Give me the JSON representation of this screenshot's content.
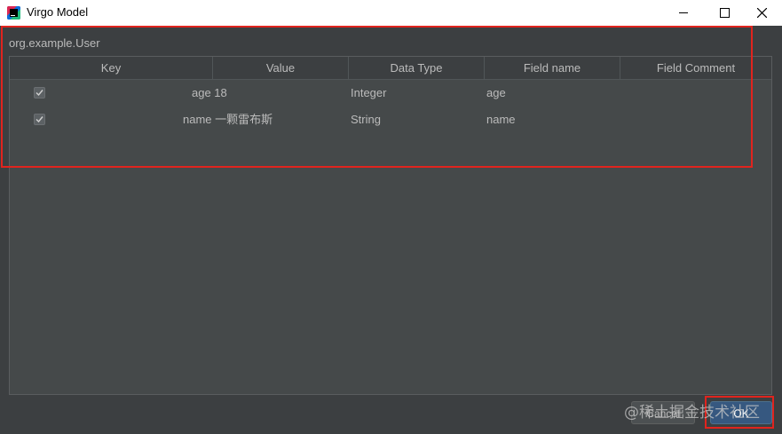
{
  "window": {
    "title": "Virgo Model",
    "icon": "intellij-app-icon"
  },
  "class_name": "org.example.User",
  "table": {
    "columns": [
      "Key",
      "Value",
      "Data Type",
      "Field name",
      "Field Comment"
    ],
    "rows": [
      {
        "checked": true,
        "value": "age 18",
        "data_type": "Integer",
        "field_name": "age",
        "field_comment": ""
      },
      {
        "checked": true,
        "value": "name 一颗雷布斯",
        "data_type": "String",
        "field_name": "name",
        "field_comment": ""
      }
    ]
  },
  "buttons": {
    "cancel": "Cancel",
    "ok": "OK"
  },
  "watermark": "@稀土掘金技术社区",
  "colors": {
    "background": "#3c3f41",
    "table_background": "#45494a",
    "highlight_frame": "#e0241e",
    "ok_button": "#365880"
  }
}
